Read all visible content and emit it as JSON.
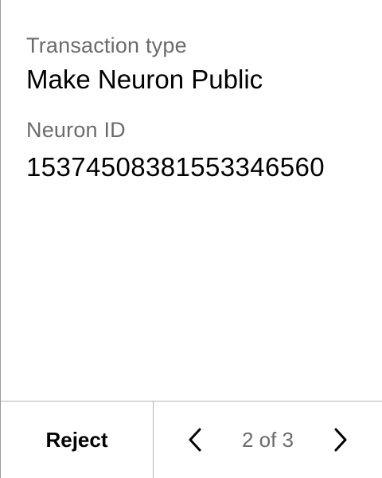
{
  "transaction": {
    "type_label": "Transaction type",
    "type_value": "Make Neuron Public",
    "neuron_label": "Neuron ID",
    "neuron_value": "15374508381553346560"
  },
  "footer": {
    "reject_label": "Reject",
    "page_indicator": "2 of 3",
    "prev_icon": "chevron-left-icon",
    "next_icon": "chevron-right-icon"
  }
}
